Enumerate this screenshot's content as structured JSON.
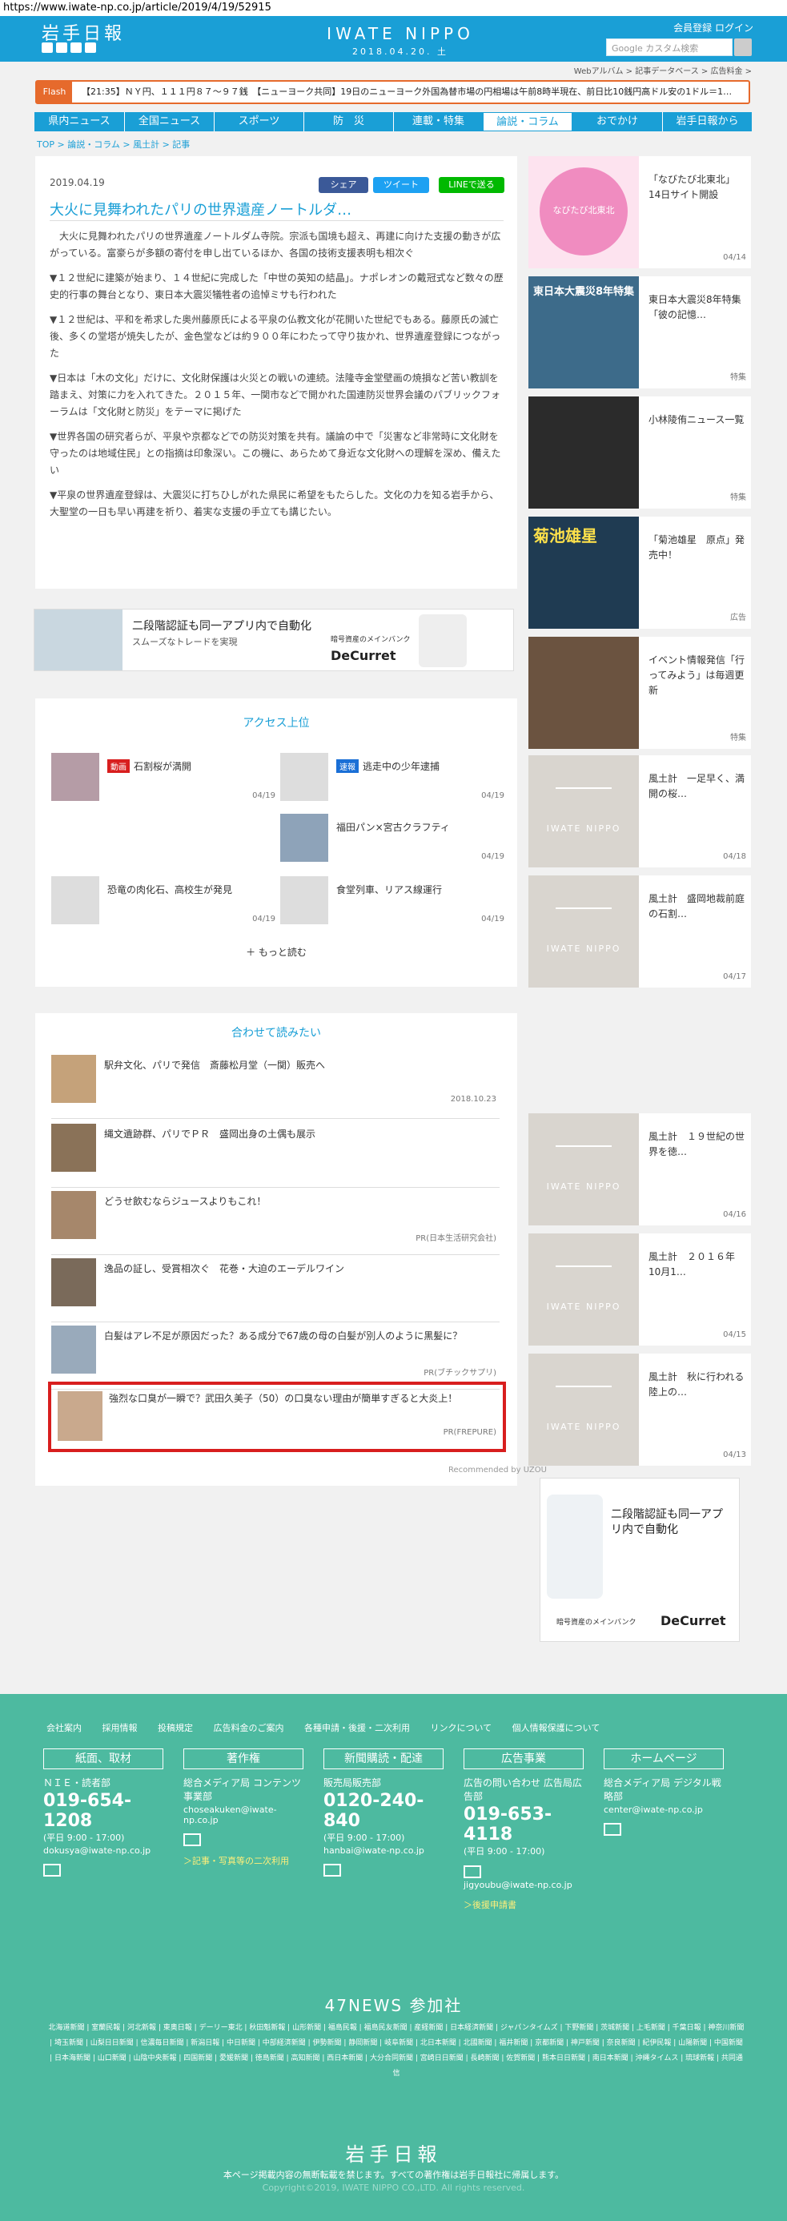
{
  "url": "https://www.iwate-np.co.jp/article/2019/4/19/52915",
  "header": {
    "logo": "岩手日報",
    "brand": "IWATE NIPPO",
    "date": "2018.04.20. 土",
    "member_links": "会員登録  ログイン",
    "search_placeholder": "Google カスタム検索",
    "sublinks": "Webアルバム  >  記事データベース  >  広告料金  >"
  },
  "flash": {
    "tag": "Flash",
    "text": "【21:35】ＮＹ円、１１１円８７～９７銭　【ニューヨーク共同】19日のニューヨーク外国為替市場の円相場は午前8時半現在、前日比10銭円高ドル安の1ドル＝1…"
  },
  "nav": [
    "県内ニュース",
    "全国ニュース",
    "スポーツ",
    "防　災",
    "連載・特集",
    "論説・コラム",
    "おでかけ",
    "岩手日報から"
  ],
  "breadcrumb": "TOP  >  論説・コラム  >  風土計  >  記事",
  "article": {
    "date": "2019.04.19",
    "title": "大火に見舞われたパリの世界遺産ノートルダ…",
    "share": [
      "シェア",
      "ツイート",
      "LINEで送る"
    ],
    "paragraphs": [
      "　大火に見舞われたパリの世界遺産ノートルダム寺院。宗派も国境も超え、再建に向けた支援の動きが広がっている。富豪らが多額の寄付を申し出ているほか、各国の技術支援表明も相次ぐ",
      "▼１２世紀に建築が始まり、１４世紀に完成した「中世の英知の結晶」。ナポレオンの戴冠式など数々の歴史的行事の舞台となり、東日本大震災犠牲者の追悼ミサも行われた",
      "▼１２世紀は、平和を希求した奥州藤原氏による平泉の仏教文化が花開いた世紀でもある。藤原氏の滅亡後、多くの堂塔が焼失したが、金色堂などは約９００年にわたって守り抜かれ、世界遺産登録につながった",
      "▼日本は「木の文化」だけに、文化財保護は火災との戦いの連続。法隆寺金堂壁画の焼損など苦い教訓を踏まえ、対策に力を入れてきた。２０１５年、一関市などで開かれた国連防災世界会議のパブリックフォーラムは「文化財と防災」をテーマに掲げた",
      "▼世界各国の研究者らが、平泉や京都などでの防災対策を共有。議論の中で「災害など非常時に文化財を守ったのは地域住民」との指摘は印象深い。この機に、あらためて身近な文化財への理解を深め、備えたい",
      "▼平泉の世界遺産登録は、大震災に打ちひしがれた県民に希望をもたらした。文化の力を知る岩手から、大聖堂の一日も早い再建を祈り、着実な支援の手立ても講じたい。"
    ]
  },
  "ad1": {
    "headline": "二段階認証も同一アプリ内で自動化",
    "sub": "スムーズなトレードを実現",
    "brand": "暗号資産のメインバンク",
    "logo": "DeCurret"
  },
  "access": {
    "title": "アクセス上位",
    "items": [
      {
        "tag": "動画",
        "label": "石割桜が満開",
        "date": "04/19",
        "color": "#d81e1e"
      },
      {
        "tag": "速報",
        "label": "逃走中の少年逮捕",
        "date": "04/19",
        "color": "#1a6fd6"
      },
      {
        "tag": "",
        "label": "福田パン×宮古クラフティ",
        "date": "04/19",
        "color": ""
      },
      {
        "tag": "",
        "label": "恐竜の肉化石、高校生が発見",
        "date": "04/19",
        "color": ""
      },
      {
        "tag": "",
        "label": "食堂列車、リアス線運行",
        "date": "04/19",
        "color": ""
      }
    ],
    "more": "もっと読む"
  },
  "related": {
    "title": "合わせて読みたい",
    "items": [
      {
        "text": "駅弁文化、パリで発信　斎藤松月堂（一関）販売へ",
        "sub": "2018.10.23"
      },
      {
        "text": "縄文遺跡群、パリでＰＲ　盛岡出身の土偶も展示",
        "sub": ""
      },
      {
        "text": "どうせ飲むならジュースよりもこれ！",
        "sub": "PR(日本生活研究会社)"
      },
      {
        "text": "逸品の証し、受賞相次ぐ　花巻・大迫のエーデルワイン",
        "sub": ""
      },
      {
        "text": "白髪はアレ不足が原因だった？ある成分で67歳の母の白髪が別人のように黒髪に？",
        "sub": "PR(ブチックサプリ)"
      },
      {
        "text": "強烈な口臭が一瞬で？武田久美子（50）の口臭ない理由が簡単すぎると大炎上！",
        "sub": "PR(FREPURE)"
      }
    ],
    "recommend": "Recommended by UZOU"
  },
  "sidebar": [
    {
      "text": "「なびたび北東北」14日サイト開設",
      "date": "04/14"
    },
    {
      "text": "東日本大震災8年特集「彼の記憶…",
      "date": "特集"
    },
    {
      "text": "小林陵侑ニュース一覧",
      "date": "特集"
    },
    {
      "text": "「菊池雄星　原点」発売中！",
      "date": "広告"
    },
    {
      "text": "イベント情報発信「行ってみよう」は毎週更新",
      "date": "特集"
    },
    {
      "text": "風土計　一足早く、満開の桜…",
      "date": "04/18"
    },
    {
      "text": "風土計　盛岡地裁前庭の石割…",
      "date": "04/17"
    },
    {
      "text": "風土計　１９世紀の世界を徳…",
      "date": "04/16"
    },
    {
      "text": "風土計　２０１６年10月1…",
      "date": "04/15"
    },
    {
      "text": "風土計　秋に行われる陸上の…",
      "date": "04/13"
    }
  ],
  "sidebar_promos": [
    "なびたび北東北",
    "東日本大震災8年特集",
    "菊池雄星"
  ],
  "ad2": {
    "headline": "二段階認証も同一アプリ内で自動化",
    "brand": "暗号資産のメインバンク",
    "logo": "DeCurret"
  },
  "footer": {
    "links": [
      "会社案内",
      "採用情報",
      "投稿規定",
      "広告料金のご案内",
      "各種申請・後援・二次利用",
      "リンクについて",
      "個人情報保護について"
    ],
    "cols": [
      {
        "head": "紙面、取材",
        "l1": "ＮＩＥ・読者部",
        "tel": "019-654-1208",
        "hours": "(平日 9:00 - 17:00)",
        "mail": "dokusya@iwate-np.co.jp",
        "link": ""
      },
      {
        "head": "著作権",
        "l1": "総合メディア局 コンテンツ事業部",
        "tel": "",
        "hours": "",
        "mail": "choseakuken@iwate-np.co.jp",
        "link": "＞記事・写真等の二次利用"
      },
      {
        "head": "新聞購読・配達",
        "l1": "販売局販売部",
        "tel": "0120-240-840",
        "hours": "(平日 9:00 - 17:00)",
        "mail": "hanbai@iwate-np.co.jp",
        "link": ""
      },
      {
        "head": "広告事業",
        "l1": "広告の問い合わせ 広告局広告部",
        "tel": "019-653-4118",
        "hours": "(平日 9:00 - 17:00)",
        "mail": "jigyoubu@iwate-np.co.jp",
        "link": "＞後援申請書"
      },
      {
        "head": "ホームページ",
        "l1": "総合メディア局 デジタル戦略部",
        "tel": "",
        "hours": "",
        "mail": "center@iwate-np.co.jp",
        "link": ""
      }
    ],
    "news47": "47NEWS 参加社",
    "members": "北海道新聞 | 室蘭民報 | 河北新報 | 東奥日報 | デーリー東北 | 秋田魁新報 | 山形新聞 | 福島民報 | 福島民友新聞 | 産経新聞 | 日本経済新聞 | ジャパンタイムズ | 下野新聞 | 茨城新聞 | 上毛新聞 | 千葉日報 | 神奈川新聞 | 埼玉新聞 | 山梨日日新聞 | 信濃毎日新聞 | 新潟日報 | 中日新聞 | 中部経済新聞 | 伊勢新聞 | 静岡新聞 | 岐阜新聞 | 北日本新聞 | 北國新聞 | 福井新聞 | 京都新聞 | 神戸新聞 | 奈良新聞 | 紀伊民報 | 山陽新聞 | 中国新聞 | 日本海新聞 | 山口新聞 | 山陰中央新報 | 四国新聞 | 愛媛新聞 | 徳島新聞 | 高知新聞 | 西日本新聞 | 大分合同新聞 | 宮崎日日新聞 | 長崎新聞 | 佐賀新聞 | 熊本日日新聞 | 南日本新聞 | 沖縄タイムス | 琉球新報 | 共同通信",
    "logo": "岩手日報",
    "notice": "本ページ掲載内容の無断転載を禁じます。すべての著作権は岩手日報社に帰属します。",
    "copyright": "Copyright©2019, IWATE NIPPO CO.,LTD. All rights reserved."
  },
  "colors": {
    "brand": "#1a9fd6",
    "footer": "#4dbaa0",
    "flash": "#e66a2c",
    "highlight": "#d81e1e"
  }
}
